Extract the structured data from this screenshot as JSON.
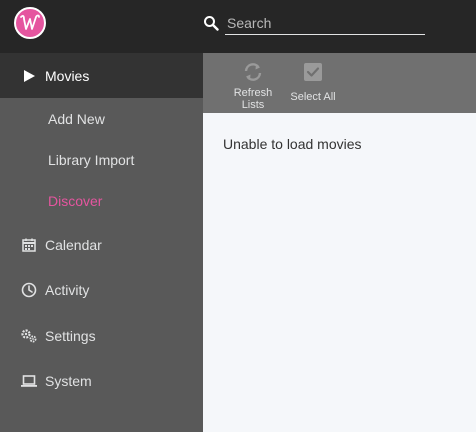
{
  "header": {
    "search_placeholder": "Search"
  },
  "sidebar": {
    "movies": "Movies",
    "sub_items": [
      "Add New",
      "Library Import",
      "Discover"
    ],
    "calendar": "Calendar",
    "activity": "Activity",
    "settings": "Settings",
    "system": "System"
  },
  "toolbar": {
    "refresh_label_1": "Refresh",
    "refresh_label_2": "Lists",
    "select_all_label": "Select All"
  },
  "content": {
    "message": "Unable to load movies"
  },
  "colors": {
    "accent": "#e5559f",
    "header": "#262626",
    "sidebar": "#595959",
    "toolbar": "#707070"
  },
  "icons": [
    "logo-icon",
    "search-icon",
    "play-icon",
    "calendar-icon",
    "clock-icon",
    "gears-icon",
    "laptop-icon",
    "refresh-icon",
    "checkbox-icon"
  ]
}
